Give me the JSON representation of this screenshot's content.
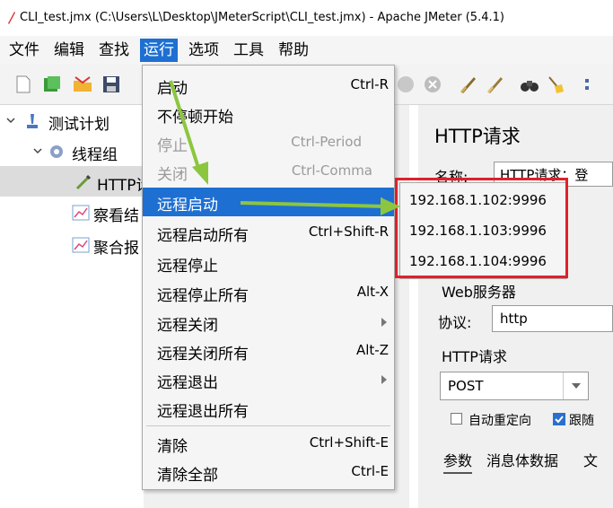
{
  "window": {
    "title": "CLI_test.jmx (C:\\Users\\L\\Desktop\\JMeterScript\\CLI_test.jmx) - Apache JMeter (5.4.1)"
  },
  "menubar": {
    "items": [
      "文件",
      "编辑",
      "查找",
      "运行",
      "选项",
      "工具",
      "帮助"
    ],
    "active": "运行"
  },
  "run_menu": {
    "items": [
      {
        "label": "启动",
        "shortcut": "Ctrl-R"
      },
      {
        "label": "不停顿开始",
        "shortcut": ""
      },
      {
        "label": "停止",
        "shortcut": "Ctrl-Period",
        "disabled": true
      },
      {
        "label": "关闭",
        "shortcut": "Ctrl-Comma",
        "disabled": true
      },
      {
        "label": "远程启动",
        "shortcut": "",
        "submenu": true,
        "highlighted": true
      },
      {
        "label": "远程启动所有",
        "shortcut": "Ctrl+Shift-R"
      },
      {
        "label": "远程停止",
        "shortcut": ""
      },
      {
        "label": "远程停止所有",
        "shortcut": "Alt-X"
      },
      {
        "label": "远程关闭",
        "shortcut": "",
        "submenu": true
      },
      {
        "label": "远程关闭所有",
        "shortcut": "Alt-Z"
      },
      {
        "label": "远程退出",
        "shortcut": "",
        "submenu": true
      },
      {
        "label": "远程退出所有",
        "shortcut": ""
      },
      {
        "label": "清除",
        "shortcut": "Ctrl+Shift-E"
      },
      {
        "label": "清除全部",
        "shortcut": "Ctrl-E"
      }
    ]
  },
  "remote_start_submenu": {
    "hosts": [
      "192.168.1.102:9996",
      "192.168.1.103:9996",
      "192.168.1.104:9996"
    ]
  },
  "tree": {
    "test_plan": "测试计划",
    "thread_group": "线程组",
    "http_request": "HTTP请",
    "view_results": "察看结",
    "aggregate": "聚合报"
  },
  "panel": {
    "heading": "HTTP请求",
    "name_label": "名称:",
    "name_value": "HTTP请求：登",
    "web_server_label": "Web服务器",
    "protocol_label": "协议:",
    "protocol_value": "http",
    "http_request_label": "HTTP请求",
    "method_value": "POST",
    "auto_redirect_label": "自动重定向",
    "follow_redirect_label": "跟随",
    "tabs": [
      "参数",
      "消息体数据",
      "文"
    ]
  },
  "colors": {
    "menu_highlight": "#1e6fd2",
    "annotation_box": "#e0202a",
    "annotation_arrow": "#8cc63f"
  }
}
